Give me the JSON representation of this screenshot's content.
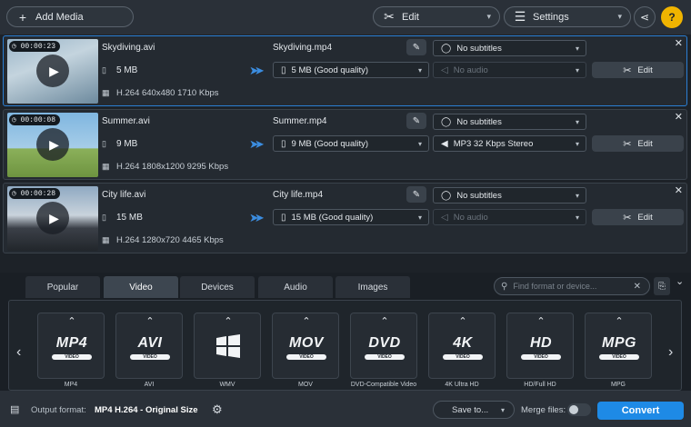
{
  "toolbar": {
    "add_media": "Add Media",
    "edit": "Edit",
    "settings": "Settings",
    "share_icon": "share-icon",
    "help": "?"
  },
  "files": [
    {
      "duration": "00:00:23",
      "source_name": "Skydiving.avi",
      "source_size": "5 MB",
      "source_info": "H.264 640x480 1710 Kbps",
      "output_name": "Skydiving.mp4",
      "output_size": "5 MB (Good quality)",
      "subtitles": "No subtitles",
      "audio": "No audio",
      "audio_disabled": true,
      "edit_label": "Edit",
      "selected": true
    },
    {
      "duration": "00:00:08",
      "source_name": "Summer.avi",
      "source_size": "9 MB",
      "source_info": "H.264 1808x1200 9295 Kbps",
      "output_name": "Summer.mp4",
      "output_size": "9 MB (Good quality)",
      "subtitles": "No subtitles",
      "audio": "MP3 32 Kbps Stereo",
      "audio_disabled": false,
      "edit_label": "Edit",
      "selected": false
    },
    {
      "duration": "00:00:28",
      "source_name": "City life.avi",
      "source_size": "15 MB",
      "source_info": "H.264 1280x720 4465 Kbps",
      "output_name": "City life.mp4",
      "output_size": "15 MB (Good quality)",
      "subtitles": "No subtitles",
      "audio": "No audio",
      "audio_disabled": true,
      "edit_label": "Edit",
      "selected": false
    }
  ],
  "format_tabs": [
    "Popular",
    "Video",
    "Devices",
    "Audio",
    "Images"
  ],
  "active_tab": "Video",
  "search_placeholder": "Find format or device...",
  "formats": [
    {
      "logo": "MP4",
      "sub": "VIDEO",
      "label": "MP4"
    },
    {
      "logo": "AVI",
      "sub": "VIDEO",
      "label": "AVI"
    },
    {
      "logo": "",
      "sub": "",
      "label": "WMV"
    },
    {
      "logo": "MOV",
      "sub": "VIDEO",
      "label": "MOV"
    },
    {
      "logo": "DVD",
      "sub": "VIDEO",
      "label": "DVD-Compatible Video"
    },
    {
      "logo": "4K",
      "sub": "VIDEO",
      "label": "4K Ultra HD"
    },
    {
      "logo": "HD",
      "sub": "VIDEO",
      "label": "HD/Full HD"
    },
    {
      "logo": "MPG",
      "sub": "VIDEO",
      "label": "MPG"
    }
  ],
  "bottom": {
    "output_format_label": "Output format:",
    "output_format_value": "MP4 H.264 - Original Size",
    "save_to": "Save to...",
    "merge_files": "Merge files:",
    "convert": "Convert"
  },
  "colors": {
    "accent": "#1e8ae6",
    "selected_border": "#2b7fd4"
  }
}
